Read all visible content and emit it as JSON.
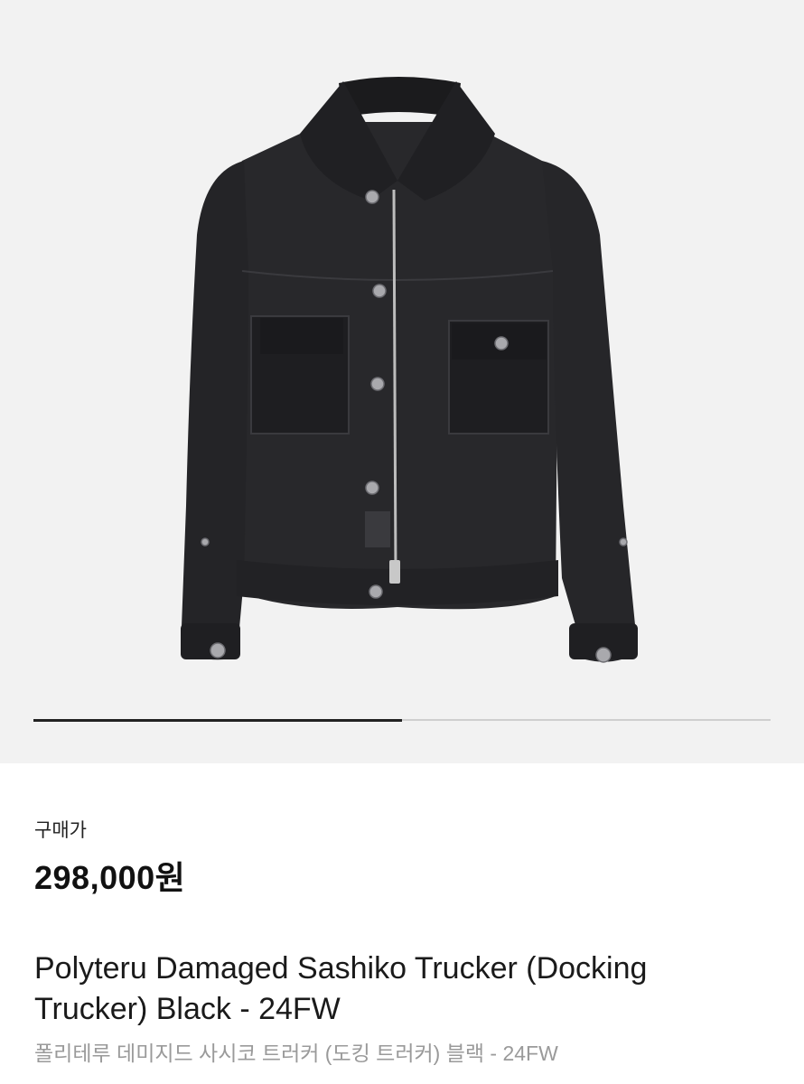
{
  "gallery": {
    "image_alt": "Polyteru Damaged Sashiko Trucker (Docking Trucker) Black - 24FW",
    "progress_fraction": 0.5
  },
  "product": {
    "price_label": "구매가",
    "price": "298,000원",
    "title_en": "Polyteru Damaged Sashiko Trucker (Docking Trucker) Black - 24FW",
    "title_ko": "폴리테루 데미지드 사시코 트러커 (도킹 트러커) 블랙 - 24FW"
  }
}
